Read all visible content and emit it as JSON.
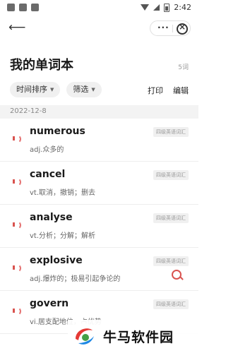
{
  "status_bar": {
    "time": "2:42"
  },
  "header": {
    "title": "我的单词本",
    "count": "5词",
    "capsule_more": "···"
  },
  "filters": [
    {
      "label": "时间排序"
    },
    {
      "label": "筛选"
    }
  ],
  "actions": {
    "print": "打印",
    "edit": "编辑"
  },
  "date_group": "2022-12-8",
  "words": [
    {
      "word": "numerous",
      "meaning": "adj.众多的",
      "tag": "四级英语词汇"
    },
    {
      "word": "cancel",
      "meaning": "vt.取消，撤销；删去",
      "tag": "四级英语词汇"
    },
    {
      "word": "analyse",
      "meaning": "vt.分析；分解；解析",
      "tag": "四级英语词汇"
    },
    {
      "word": "explosive",
      "meaning": "adj.爆炸的；极易引起争论的",
      "tag": "四级英语词汇"
    },
    {
      "word": "govern",
      "meaning": "vi.居支配地位，占优势",
      "tag": "四级英语词汇"
    }
  ],
  "watermark": {
    "text": "牛马软件园"
  },
  "colors": {
    "accent": "#d9534f",
    "separator": "#eeeeee",
    "date_bar": "#f3f3f3"
  }
}
